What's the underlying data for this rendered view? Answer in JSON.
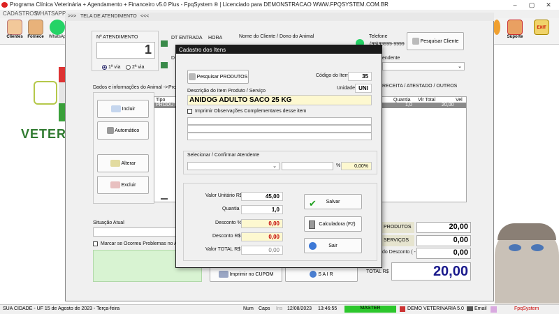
{
  "app": {
    "title": "Programa Clínica Veterinária + Agendamento + Financeiro v5.0 Plus - FpqSystem ® | Licenciado para  DEMONSTRACAO WWW.FPQSYSTEM.COM.BR"
  },
  "menu": {
    "items": [
      "CADASTROS",
      "WHATSAPP"
    ]
  },
  "toolbar": {
    "clientes": "Clientes",
    "fornece": "Fornece",
    "whatsapp": "WhatsAp",
    "suporte": "Suporte",
    "sair": "EXIT"
  },
  "sidebar": {
    "logo_text": "VETER"
  },
  "tela": {
    "title": "TELA DE ATENDIMENTO",
    "title_prefix": ">>>",
    "title_suffix": "<<<",
    "atendimento_label": "Nº ATENDIMENTO",
    "atendimento_value": "1",
    "via1": "1ª via",
    "via2": "2ª via",
    "dt_entrada_label": "DT ENTRADA",
    "hora_label": "HORA",
    "dt_label": "D",
    "nome_cliente_label": "Nome do Cliente / Dono do Animal",
    "telefone_label": "Telefone",
    "telefone_value": "(99)99999-9999",
    "pesquisar_cliente": "Pesquisar Cliente",
    "atendente_label": "endente",
    "tab_dados": "Dados e informações do Animal",
    "tab_arrow": "->",
    "tab_prod": "Pro",
    "tab_receita": "RECEITA / ATESTADO / OUTROS",
    "btn_incluir": "Incluir",
    "btn_automatico": "Automático",
    "btn_alterar": "Alterar",
    "btn_excluir": "Excluir",
    "grid_col_tipo": "Tipo",
    "grid_row_tipo": "PRODUTO",
    "grid_cols": [
      "Quantia",
      "Vlr Total",
      "Vel"
    ],
    "grid_row": [
      "1,0",
      "20,00"
    ],
    "situacao_label": "Situação Atual",
    "problemas_label": "Marcar se Ocorreu Problemas no Atend",
    "imprimir_cupom": "Imprimir no CUPOM",
    "sair": "S A I R",
    "total_produtos_label": "PRODUTOS",
    "total_produtos": "20,00",
    "total_servicos_label": "SERVIÇOS",
    "total_servicos": "0,00",
    "desconto_label": "do Desconto ( - )",
    "desconto": "0,00",
    "total_label": "TOTAL R$",
    "total": "20,00"
  },
  "modal": {
    "title": "Cadastro dos Itens",
    "pesquisar_produtos": "Pesquisar PRODUTOS",
    "codigo_label": "Código do Item",
    "codigo_value": "35",
    "unidade_label": "Unidade",
    "unidade_value": "UNI",
    "descricao_label": "Descrição do Item Produto / Serviço",
    "descricao_value": "ANIDOG ADULTO SACO 25 KG",
    "imprimir_obs": "Imprimir Observações Complementares desse item",
    "atendente_label": "Selecionar / Confirmar Atendente",
    "percent_symbol": "%",
    "percent_value": "0,00%",
    "valor_unitario_label": "Valor Unitário R$",
    "valor_unitario": "45,00",
    "quantia_label": "Quantia",
    "quantia": "1,0",
    "desconto_pct_label": "Desconto %",
    "desconto_pct": "0,00",
    "desconto_rs_label": "Desconto R$",
    "desconto_rs": "0,00",
    "valor_total_label": "Valor TOTAL R$",
    "valor_total": "0,00",
    "btn_salvar": "Salvar",
    "btn_calculadora": "Calculadora (F2)",
    "btn_sair": "Sair"
  },
  "status": {
    "cidade": "SUA CIDADE - UF 15 de Agosto de 2023 - Terça-feira",
    "num": "Num",
    "caps": "Caps",
    "ins": "Ins",
    "date": "12/08/2023",
    "time": "13:46:55",
    "master": "MASTER",
    "empresa": "DEMO VETERINARIA 5.0",
    "email": "Email",
    "brand": "FpqSystem"
  },
  "colors": {
    "modal_title_bg": "#1b1b1b",
    "highlight_green": "#2cc72c",
    "vet_green": "#2f7a2f",
    "total_blue": "#1a1a8c"
  }
}
